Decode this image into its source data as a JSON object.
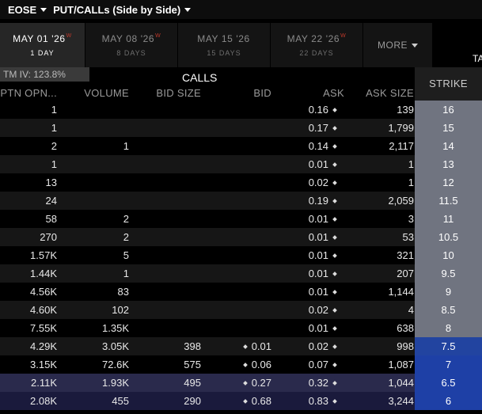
{
  "header": {
    "symbol": "EOSE",
    "view": "PUT/CALLs (Side by Side)"
  },
  "tabs": [
    {
      "date": "MAY 01 '26",
      "weekly": "W",
      "days": "1 DAY",
      "active": true
    },
    {
      "date": "MAY 08 '26",
      "weekly": "W",
      "days": "8 DAYS",
      "active": false
    },
    {
      "date": "MAY 15 '26",
      "weekly": "",
      "days": "15 DAYS",
      "active": false
    },
    {
      "date": "MAY 22 '26",
      "weekly": "W",
      "days": "22 DAYS",
      "active": false
    }
  ],
  "more_label": "MORE",
  "ta_label": "TA",
  "iv_label": "TM IV: 123.8%",
  "calls_title": "CALLS",
  "columns": {
    "opn": "PTN OPN...",
    "volume": "VOLUME",
    "bid_size": "BID SIZE",
    "bid": "BID",
    "ask": "ASK",
    "ask_size": "ASK SIZE",
    "strike": "STRIKE"
  },
  "rows": [
    {
      "opn": "1",
      "volume": "",
      "bid_size": "",
      "bid": "",
      "ask": "0.16",
      "ask_size": "139",
      "strike": "16"
    },
    {
      "opn": "1",
      "volume": "",
      "bid_size": "",
      "bid": "",
      "ask": "0.17",
      "ask_size": "1,799",
      "strike": "15"
    },
    {
      "opn": "2",
      "volume": "1",
      "bid_size": "",
      "bid": "",
      "ask": "0.14",
      "ask_size": "2,117",
      "strike": "14"
    },
    {
      "opn": "1",
      "volume": "",
      "bid_size": "",
      "bid": "",
      "ask": "0.01",
      "ask_size": "1",
      "strike": "13"
    },
    {
      "opn": "13",
      "volume": "",
      "bid_size": "",
      "bid": "",
      "ask": "0.02",
      "ask_size": "1",
      "strike": "12"
    },
    {
      "opn": "24",
      "volume": "",
      "bid_size": "",
      "bid": "",
      "ask": "0.19",
      "ask_size": "2,059",
      "strike": "11.5"
    },
    {
      "opn": "58",
      "volume": "2",
      "bid_size": "",
      "bid": "",
      "ask": "0.01",
      "ask_size": "3",
      "strike": "11"
    },
    {
      "opn": "270",
      "volume": "2",
      "bid_size": "",
      "bid": "",
      "ask": "0.01",
      "ask_size": "53",
      "strike": "10.5"
    },
    {
      "opn": "1.57K",
      "volume": "5",
      "bid_size": "",
      "bid": "",
      "ask": "0.01",
      "ask_size": "321",
      "strike": "10"
    },
    {
      "opn": "1.44K",
      "volume": "1",
      "bid_size": "",
      "bid": "",
      "ask": "0.01",
      "ask_size": "207",
      "strike": "9.5"
    },
    {
      "opn": "4.56K",
      "volume": "83",
      "bid_size": "",
      "bid": "",
      "ask": "0.01",
      "ask_size": "1,144",
      "strike": "9"
    },
    {
      "opn": "4.60K",
      "volume": "102",
      "bid_size": "",
      "bid": "",
      "ask": "0.02",
      "ask_size": "4",
      "strike": "8.5"
    },
    {
      "opn": "7.55K",
      "volume": "1.35K",
      "bid_size": "",
      "bid": "",
      "ask": "0.01",
      "ask_size": "638",
      "strike": "8"
    },
    {
      "opn": "4.29K",
      "volume": "3.05K",
      "bid_size": "398",
      "bid": "0.01",
      "ask": "0.02",
      "ask_size": "998",
      "strike": "7.5"
    },
    {
      "opn": "3.15K",
      "volume": "72.6K",
      "bid_size": "575",
      "bid": "0.06",
      "ask": "0.07",
      "ask_size": "1,087",
      "strike": "7"
    },
    {
      "opn": "2.11K",
      "volume": "1.93K",
      "bid_size": "495",
      "bid": "0.27",
      "ask": "0.32",
      "ask_size": "1,044",
      "strike": "6.5"
    },
    {
      "opn": "2.08K",
      "volume": "455",
      "bid_size": "290",
      "bid": "0.68",
      "ask": "0.83",
      "ask_size": "3,244",
      "strike": "6"
    }
  ],
  "colors": {
    "strike_otm": "#707480",
    "strike_atm": "#2244a0",
    "strike_itm": "#1e40a6",
    "itm_row": "#2a2a4c"
  }
}
